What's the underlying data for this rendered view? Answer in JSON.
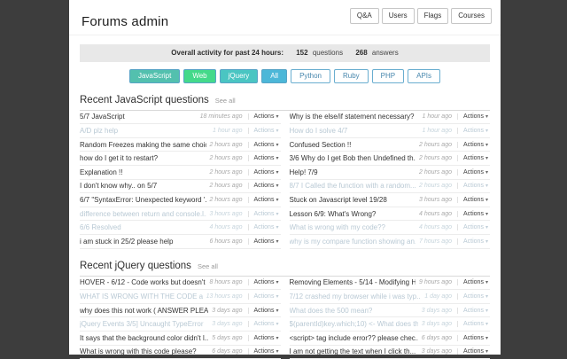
{
  "page": {
    "title": "Forums admin"
  },
  "nav": [
    {
      "label": "Q&A"
    },
    {
      "label": "Users"
    },
    {
      "label": "Flags"
    },
    {
      "label": "Courses"
    }
  ],
  "activity": {
    "label": "Overall activity for past 24 hours:",
    "questions_count": "152",
    "questions_label": "questions",
    "answers_count": "268",
    "answers_label": "answers"
  },
  "filters": [
    {
      "label": "JavaScript",
      "active": true,
      "color": "#53c0ae"
    },
    {
      "label": "Web",
      "active": true,
      "color": "#44d98a"
    },
    {
      "label": "jQuery",
      "active": true,
      "color": "#4ac5c2"
    },
    {
      "label": "All",
      "active": true,
      "color": "#4cb7d8"
    },
    {
      "label": "Python",
      "active": false
    },
    {
      "label": "Ruby",
      "active": false
    },
    {
      "label": "PHP",
      "active": false
    },
    {
      "label": "APIs",
      "active": false
    }
  ],
  "actions": {
    "label": "Actions",
    "caret": "▾"
  },
  "sections": [
    {
      "title": "Recent JavaScript questions",
      "see_all": "See all",
      "columns": [
        [
          {
            "title": "5/7 JavaScript",
            "time": "18 minutes ago",
            "read": false
          },
          {
            "title": "A/D plz help",
            "time": "1 hour ago",
            "read": true
          },
          {
            "title": "Random Freezes making the same choic...",
            "time": "2 hours ago",
            "read": false
          },
          {
            "title": "how do I get it to restart?",
            "time": "2 hours ago",
            "read": false
          },
          {
            "title": "Explanation !!",
            "time": "2 hours ago",
            "read": false
          },
          {
            "title": "I don't know why.. on 5/7",
            "time": "2 hours ago",
            "read": false
          },
          {
            "title": "6/7 \"SyntaxError: Unexpected keyword '...",
            "time": "2 hours ago",
            "read": false
          },
          {
            "title": "difference between return and console.l...",
            "time": "3 hours ago",
            "read": true
          },
          {
            "title": "6/6 Resolved",
            "time": "4 hours ago",
            "read": true
          },
          {
            "title": "i am stuck in 25/2 please help",
            "time": "6 hours ago",
            "read": false
          }
        ],
        [
          {
            "title": "Why is the else/if statement necessary?",
            "time": "1 hour ago",
            "read": false
          },
          {
            "title": "How do I solve 4/7",
            "time": "1 hour ago",
            "read": true
          },
          {
            "title": "Confused Section !!",
            "time": "2 hours ago",
            "read": false
          },
          {
            "title": "3/6 Why do I get Bob then Undefined th...",
            "time": "2 hours ago",
            "read": false
          },
          {
            "title": "Help! 7/9",
            "time": "2 hours ago",
            "read": false
          },
          {
            "title": "8/7 I Called the function with a random...",
            "time": "2 hours ago",
            "read": true
          },
          {
            "title": "Stuck on Javascript level 19/28",
            "time": "3 hours ago",
            "read": false
          },
          {
            "title": "Lesson 6/9: What's Wrong?",
            "time": "4 hours ago",
            "read": false
          },
          {
            "title": "What is wrong with my code??",
            "time": "4 hours ago",
            "read": true
          },
          {
            "title": "why is my compare function showing an...",
            "time": "7 hours ago",
            "read": true
          }
        ]
      ]
    },
    {
      "title": "Recent jQuery questions",
      "see_all": "See all",
      "columns": [
        [
          {
            "title": "HOVER - 6/12 - Code works but doesn't a...",
            "time": "8 hours ago",
            "read": false
          },
          {
            "title": "WHAT IS WRONG WITH THE CODE and ...",
            "time": "13 hours ago",
            "read": true
          },
          {
            "title": "why does this not work ( ANSWER PLEA...",
            "time": "3 days ago",
            "read": false
          },
          {
            "title": "jQuery Events 3/5] Uncaught TypeError",
            "time": "3 days ago",
            "read": true
          },
          {
            "title": "It says that the background color didn't l...",
            "time": "5 days ago",
            "read": false
          },
          {
            "title": "What is wrong with this code please?",
            "time": "6 days ago",
            "read": false
          }
        ],
        [
          {
            "title": "Removing Elements - 5/14 - Modifying H...",
            "time": "9 hours ago",
            "read": false
          },
          {
            "title": "7/12 crashed my browser while i was typ...",
            "time": "1 day ago",
            "read": true
          },
          {
            "title": "What does the 500 mean?",
            "time": "3 days ago",
            "read": true
          },
          {
            "title": "$(parentId)key.which;10) <- What does thi...",
            "time": "3 days ago",
            "read": true
          },
          {
            "title": "<script> tag include error?? please chec...",
            "time": "6 days ago",
            "read": false
          },
          {
            "title": "I am not getting the text when I click th...",
            "time": "3 days ago",
            "read": false
          }
        ]
      ]
    }
  ]
}
